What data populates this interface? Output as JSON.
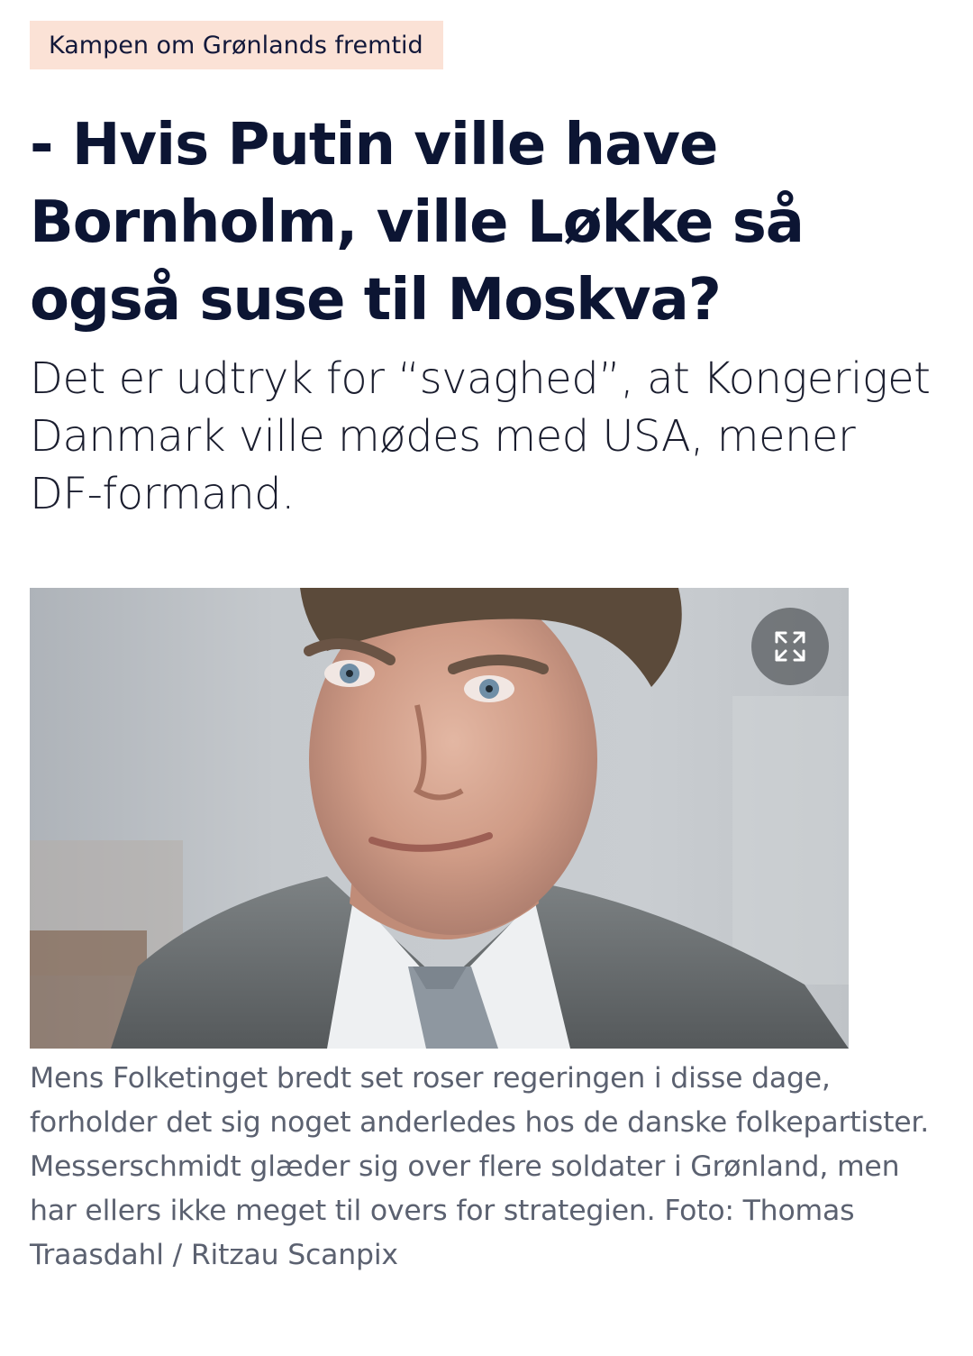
{
  "article": {
    "topic_tag": "Kampen om Grønlands fremtid",
    "headline": "- Hvis Putin ville have Bornholm, ville Løkke så også suse til Moskva?",
    "subheadline": "Det er udtryk for “svaghed”, at Kongeriget Danmark ville mødes med USA, mener DF-formand.",
    "photo": {
      "caption": "Mens Folketinget bredt set roser regeringen i disse dage, forholder det sig noget anderledes hos de danske folkepartister. Messerschmidt glæder sig over flere soldater i Grønland, men har ellers ikke meget til overs for strategien.",
      "credit": "Foto: Thomas Traasdahl / Ritzau Scanpix",
      "expand_icon": "expand-arrows-icon"
    }
  },
  "colors": {
    "tag_background": "#fbe2d6",
    "headline_text": "#0c1533",
    "caption_text": "#5b6170",
    "expand_button_bg": "#5c6064"
  }
}
